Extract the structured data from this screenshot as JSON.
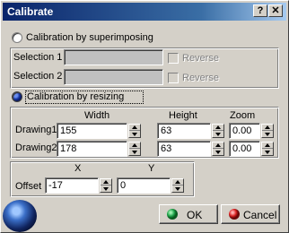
{
  "window": {
    "title": "Calibrate",
    "help_glyph": "?",
    "close_glyph": "✕"
  },
  "superimpose": {
    "label": "Calibration by superimposing",
    "selection1_label": "Selection 1",
    "selection2_label": "Selection 2",
    "reverse1_label": "Reverse",
    "reverse2_label": "Reverse"
  },
  "resize": {
    "label": "Calibration by resizing",
    "headers": {
      "width": "Width",
      "height": "Height",
      "zoom": "Zoom"
    },
    "rows": [
      {
        "label": "Drawing1",
        "width": "155",
        "height": "63",
        "zoom": "0.00"
      },
      {
        "label": "Drawing2",
        "width": "178",
        "height": "63",
        "zoom": "0.00"
      }
    ],
    "offset": {
      "label": "Offset",
      "x_header": "X",
      "y_header": "Y",
      "x": "-17",
      "y": "0"
    }
  },
  "buttons": {
    "ok": "OK",
    "cancel": "Cancel"
  },
  "colors": {
    "ok_dot": "#1fa34a",
    "cancel_dot": "#d82020",
    "title_start": "#0a246a"
  },
  "icons": {
    "ok": "green-ball-icon",
    "cancel": "red-ball-icon",
    "decor": "globe-icon"
  }
}
